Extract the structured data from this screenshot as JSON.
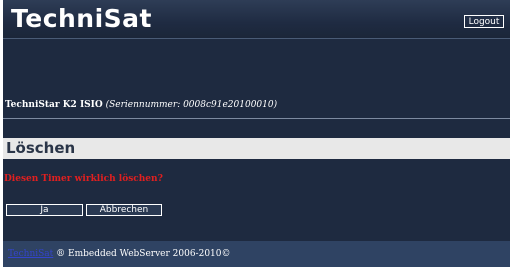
{
  "header": {
    "logo": "TechniSat",
    "logout_label": "Logout"
  },
  "device": {
    "model": "TechniStar K2 ISIO",
    "serial": "(Seriennummer: 0008c91e20100010)"
  },
  "page": {
    "title": "Löschen",
    "question": "Diesen Timer wirklich löschen?"
  },
  "buttons": {
    "yes": "Ja",
    "cancel": "Abbrechen"
  },
  "footer": {
    "link": "TechniSat",
    "text": " ® Embedded WebServer 2006-2010©"
  },
  "colors": {
    "background": "#1e2a40",
    "accent_red": "#e21f1f",
    "footer_bg": "#2f4363"
  }
}
